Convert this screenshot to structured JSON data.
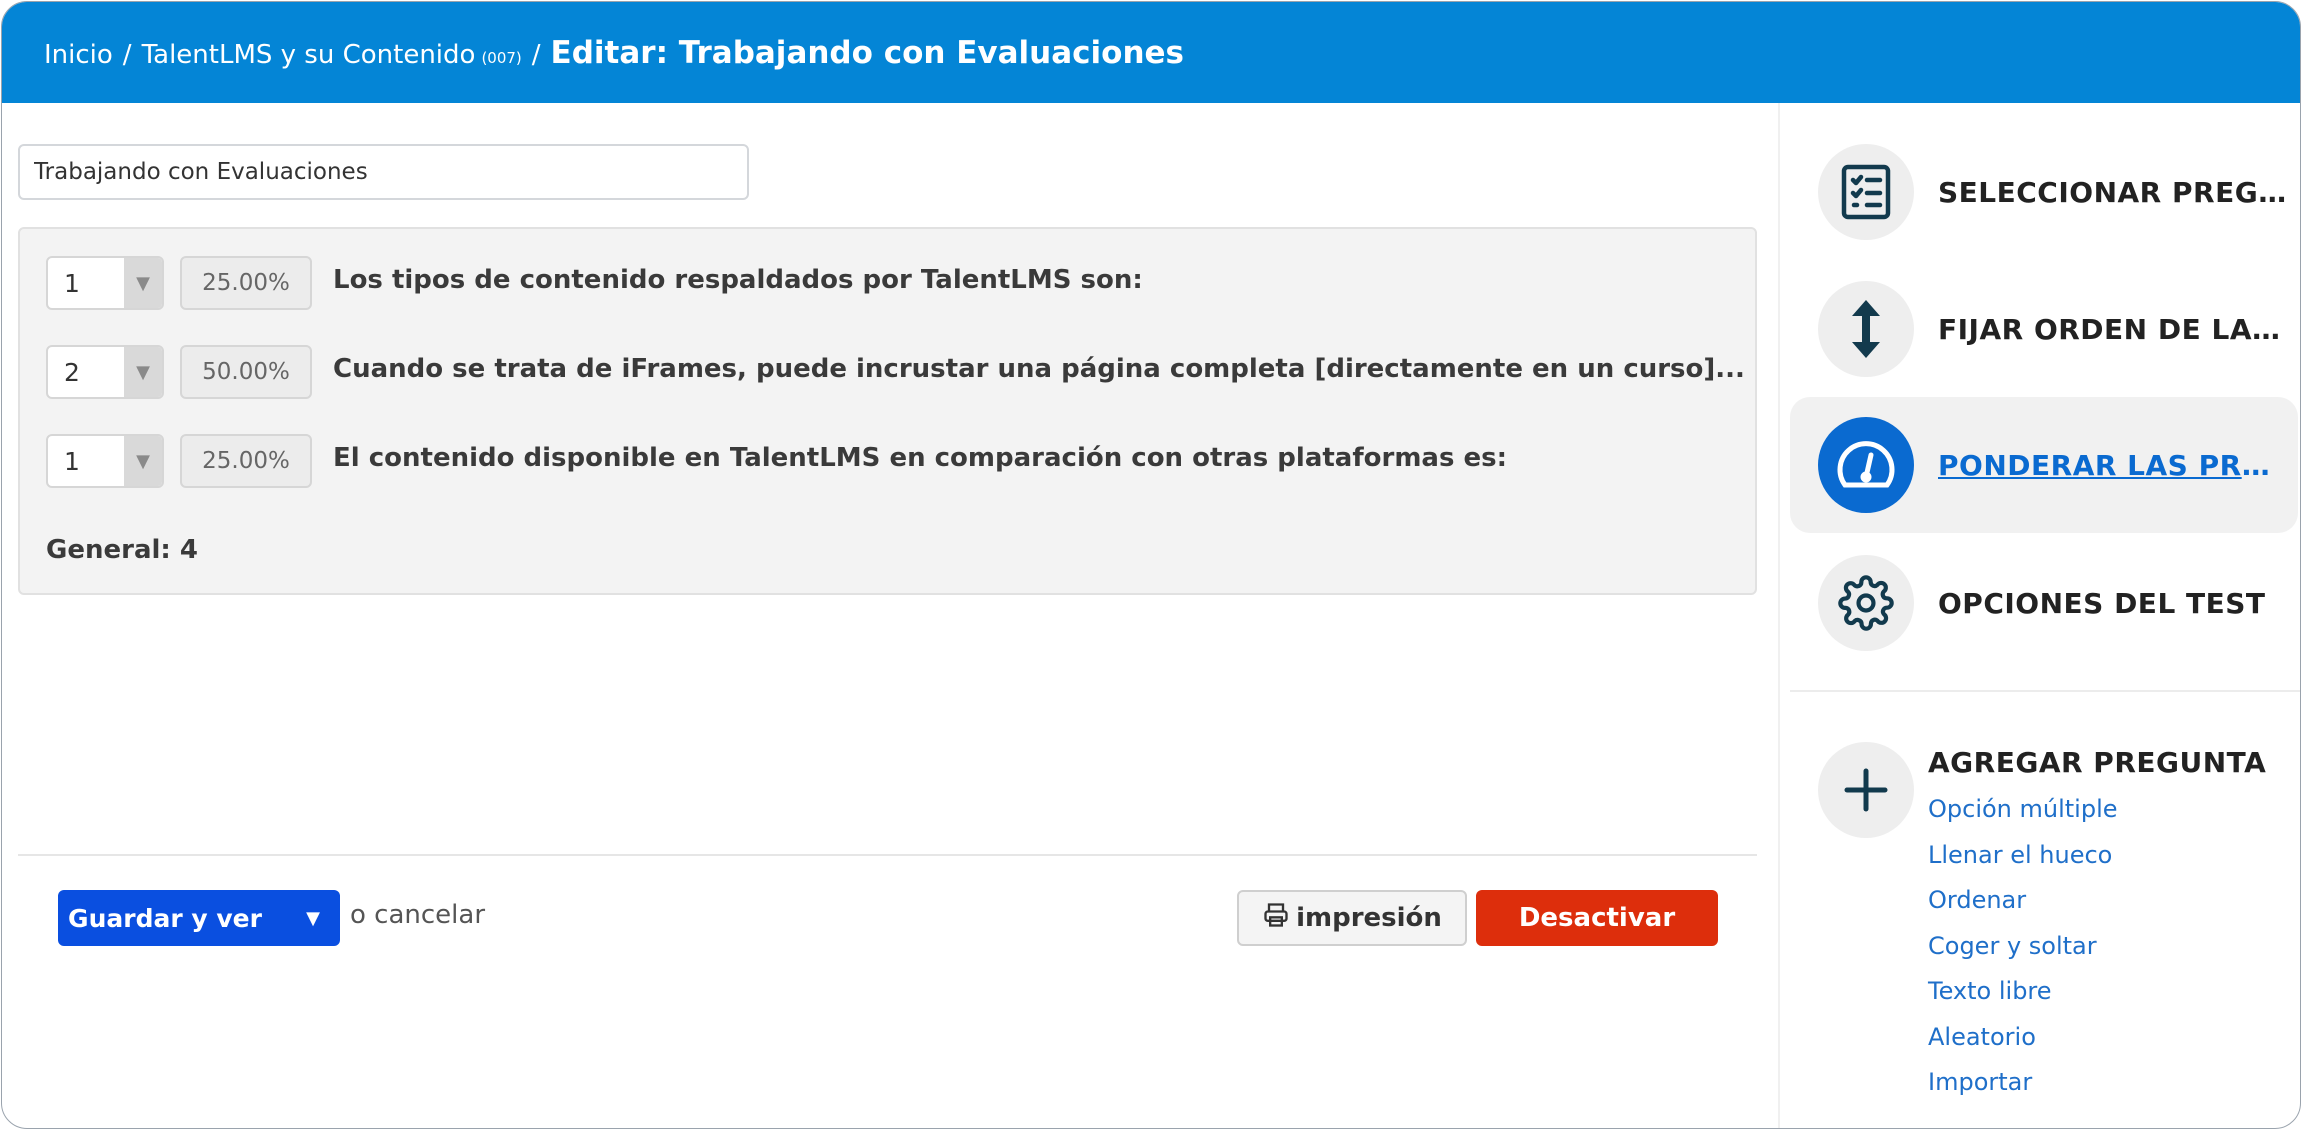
{
  "header": {
    "breadcrumb_home": "Inicio",
    "breadcrumb_sep1": "/",
    "breadcrumb_course": "TalentLMS y su Contenido",
    "breadcrumb_course_code": "(007)",
    "breadcrumb_sep2": "/",
    "page_title": "Editar: Trabajando con Evaluaciones"
  },
  "test_name_value": "Trabajando con Evaluaciones",
  "questions": [
    {
      "weight": "1",
      "percent": "25.00%",
      "text": "Los tipos de contenido respaldados por TalentLMS son:"
    },
    {
      "weight": "2",
      "percent": "50.00%",
      "text": "Cuando se trata de iFrames, puede incrustar una página completa [directamente en un curso]..."
    },
    {
      "weight": "1",
      "percent": "25.00%",
      "text": "El contenido disponible en TalentLMS en comparación con otras plataformas es:"
    }
  ],
  "general_total": "General: 4",
  "footer": {
    "save_label": "Guardar y ver",
    "cancel_text": "o cancelar",
    "print_label": "impresión",
    "deactivate_label": "Desactivar"
  },
  "sidebar": {
    "items": [
      {
        "label": "SELECCIONAR PREGUNT...",
        "icon": "question-list-icon",
        "active": false
      },
      {
        "label": "FIJAR ORDEN DE LAS PR...",
        "icon": "vertical-arrows-icon",
        "active": false
      },
      {
        "label": "PONDERAR LAS PREGU...",
        "icon": "gauge-icon",
        "active": true
      },
      {
        "label": "OPCIONES DEL TEST",
        "icon": "gear-icon",
        "active": false
      }
    ],
    "add_question_title": "AGREGAR PREGUNTA",
    "question_types": [
      "Opción múltiple",
      "Llenar el hueco",
      "Ordenar",
      "Coger y soltar",
      "Texto libre",
      "Aleatorio",
      "Importar"
    ]
  },
  "colors": {
    "header_bg": "#0485d6",
    "primary_button": "#0a4fe0",
    "danger_button": "#dd2e0c",
    "active_sidebar": "#0a6ad0",
    "link": "#1f6fc9"
  }
}
